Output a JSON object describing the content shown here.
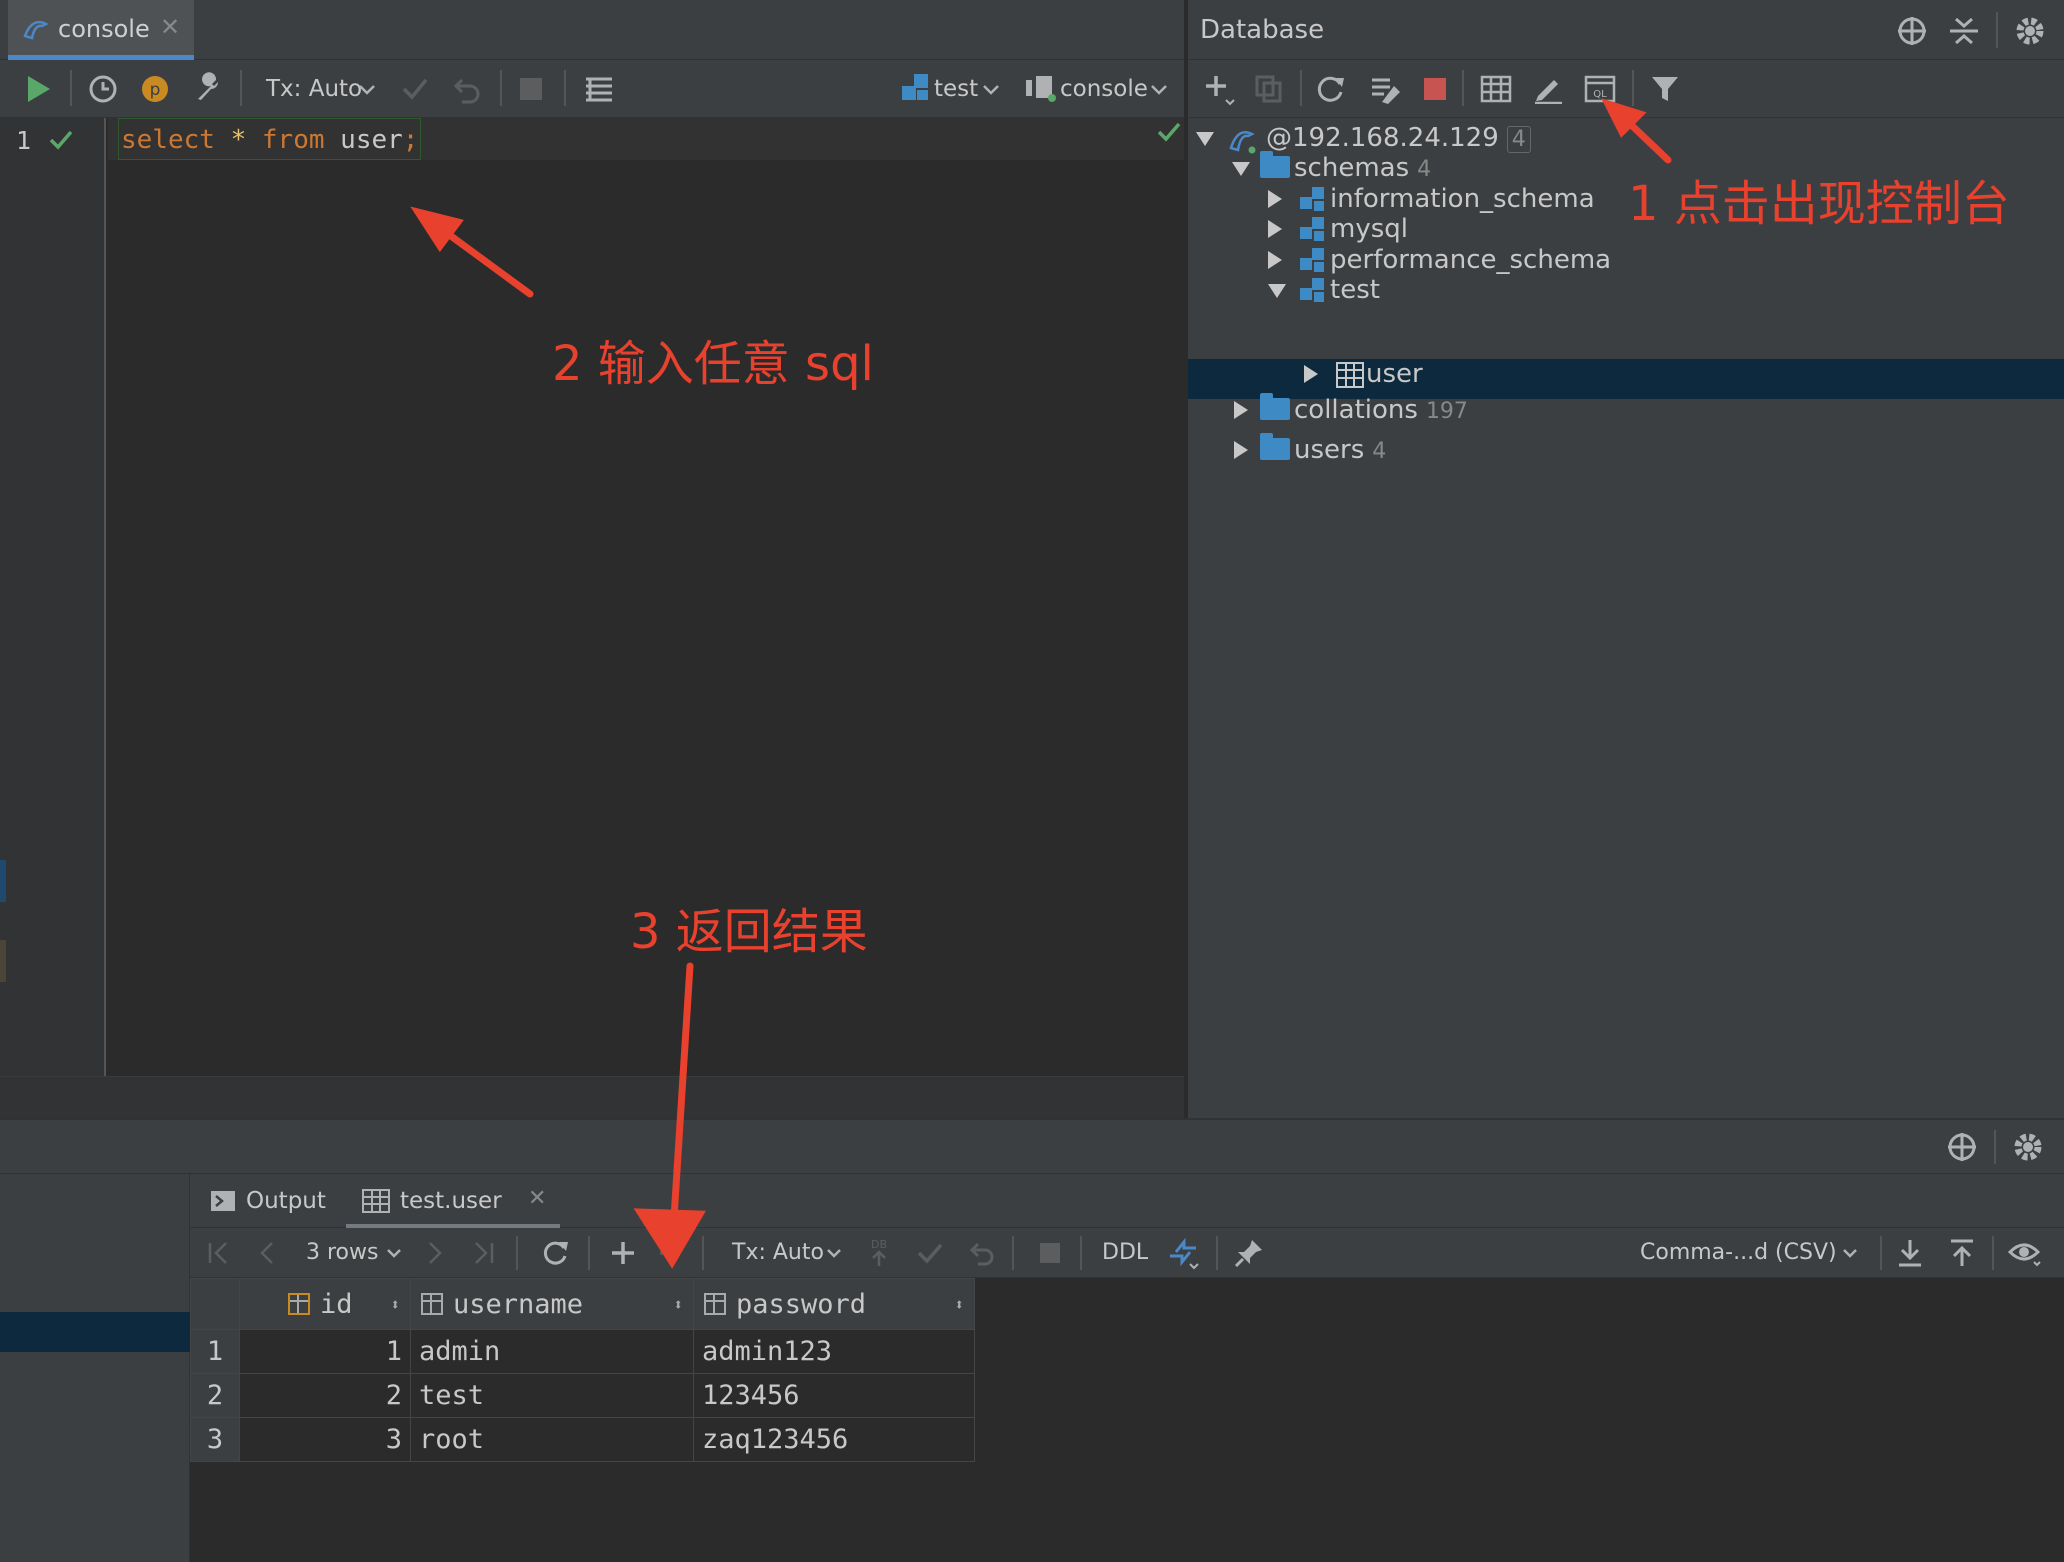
{
  "editor": {
    "tab_label": "console",
    "toolbar": {
      "tx_mode": "Tx: Auto",
      "schema_selector": "test",
      "session_selector": "console"
    },
    "line_number": "1",
    "code": {
      "kw1": "select",
      "star": " * ",
      "kw2": "from",
      "table": " user",
      "semi": ";"
    }
  },
  "database_panel": {
    "title": "Database",
    "tree": [
      {
        "label": "@192.168.24.129",
        "count": "4"
      },
      {
        "label": "schemas",
        "count": "4"
      },
      {
        "label": "information_schema"
      },
      {
        "label": "mysql"
      },
      {
        "label": "performance_schema"
      },
      {
        "label": "test"
      },
      {
        "label": "user"
      },
      {
        "label": "collations",
        "count": "197"
      },
      {
        "label": "users",
        "count": "4"
      }
    ]
  },
  "results": {
    "tabs": [
      {
        "label": "Output"
      },
      {
        "label": "test.user"
      }
    ],
    "toolbar": {
      "rows": "3 rows",
      "tx_mode": "Tx: Auto",
      "ddl": "DDL",
      "format": "Comma-...d (CSV)"
    },
    "columns": [
      "id",
      "username",
      "password"
    ],
    "rows": [
      {
        "n": "1",
        "id": "1",
        "username": "admin",
        "password": "admin123"
      },
      {
        "n": "2",
        "id": "2",
        "username": "test",
        "password": "123456"
      },
      {
        "n": "3",
        "id": "3",
        "username": "root",
        "password": "zaq123456"
      }
    ]
  },
  "annotations": {
    "step1": "1 点击出现控制台",
    "step2": "2 输入任意 sql",
    "step3": "3 返回结果"
  },
  "colors": {
    "annotation": "#e8412d",
    "selection": "#0d293e",
    "keyword": "#cc7832",
    "accent": "#4a88c7"
  }
}
